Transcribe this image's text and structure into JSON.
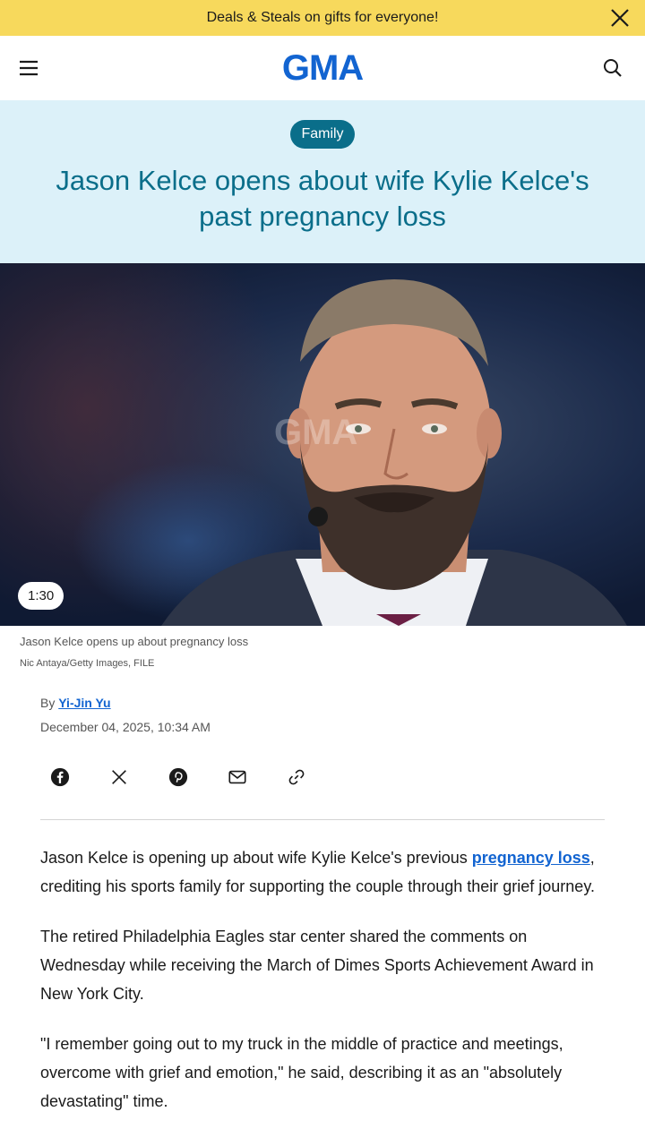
{
  "promo": {
    "text": "Deals & Steals on gifts for everyone!",
    "close_icon": "close-icon"
  },
  "header": {
    "logo": "GMA",
    "menu_icon": "hamburger-menu-icon",
    "search_icon": "search-icon"
  },
  "article": {
    "category": "Family",
    "headline": "Jason Kelce opens about wife Kylie Kelce's past pregnancy loss",
    "video": {
      "duration": "1:30",
      "watermark": "GMA"
    },
    "caption": "Jason Kelce opens up about pregnancy loss",
    "credit": "Nic Antaya/Getty Images, FILE",
    "byline_prefix": "By",
    "author": "Yi-Jin Yu",
    "date": "December 04, 2025, 10:34 AM",
    "share_icons": [
      "facebook-icon",
      "x-icon",
      "pinterest-icon",
      "email-icon",
      "link-icon"
    ],
    "paragraphs": {
      "p1_before": "Jason Kelce is opening up about wife Kylie Kelce's previous ",
      "p1_link": "pregnancy loss",
      "p1_after": ", crediting his sports family for supporting the couple through their grief journey.",
      "p2": "The retired Philadelphia Eagles star center shared the comments on Wednesday while receiving the March of Dimes Sports Achievement Award in New York City.",
      "p3": "\"I remember going out to my truck in the middle of practice and meetings, overcome with grief and emotion,\" he said, describing it as an \"absolutely devastating\" time."
    }
  },
  "colors": {
    "promo_bg": "#f7d95c",
    "brand_blue": "#1264d1",
    "hero_bg": "#dcf1f9",
    "teal": "#0a6e8a"
  }
}
